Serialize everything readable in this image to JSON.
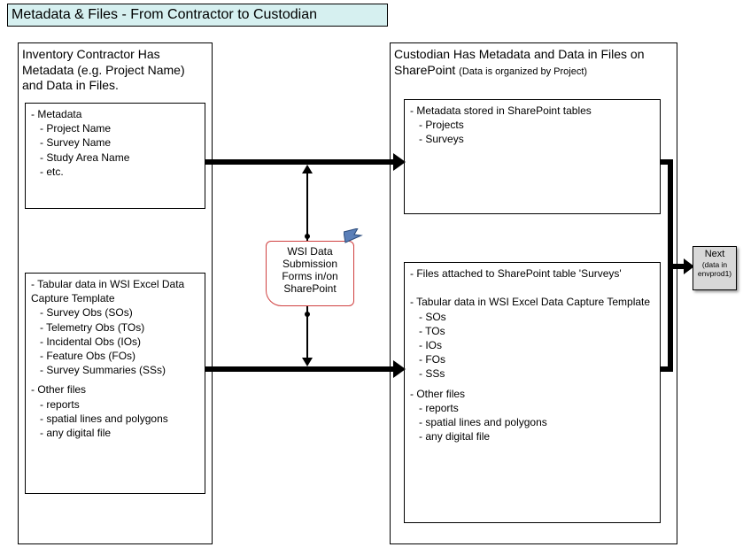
{
  "title": "Metadata & Files - From Contractor to Custodian",
  "left": {
    "heading": "Inventory Contractor Has Metadata (e.g. Project Name) and Data in Files.",
    "metadata": {
      "heading": "Metadata",
      "items": [
        "Project Name",
        "Survey Name",
        "Study Area Name",
        "etc."
      ]
    },
    "data": {
      "heading": "Tabular data in WSI Excel Data Capture Template",
      "items": [
        "Survey Obs (SOs)",
        "Telemetry Obs (TOs)",
        "Incidental Obs (IOs)",
        "Feature Obs (FOs)",
        "Survey Summaries (SSs)"
      ],
      "other_heading": "Other files",
      "other_items": [
        "reports",
        "spatial lines and polygons",
        "any digital file"
      ]
    }
  },
  "middle": {
    "label": "WSI Data Submission Forms in/on SharePoint"
  },
  "right": {
    "heading_main": "Custodian Has Metadata and Data in Files on SharePoint",
    "heading_sub": "(Data is organized by Project)",
    "metadata": {
      "heading": "Metadata stored in SharePoint tables",
      "items": [
        "Projects",
        "Surveys"
      ]
    },
    "data": {
      "heading": "Files attached to SharePoint table 'Surveys'",
      "tabular_heading": "Tabular data in WSI Excel Data Capture Template",
      "tabular_items": [
        "SOs",
        "TOs",
        "IOs",
        "FOs",
        "SSs"
      ],
      "other_heading": "Other files",
      "other_items": [
        "reports",
        "spatial lines and polygons",
        "any digital file"
      ]
    }
  },
  "next": {
    "label": "Next",
    "sub": "(data in envprod1)"
  }
}
